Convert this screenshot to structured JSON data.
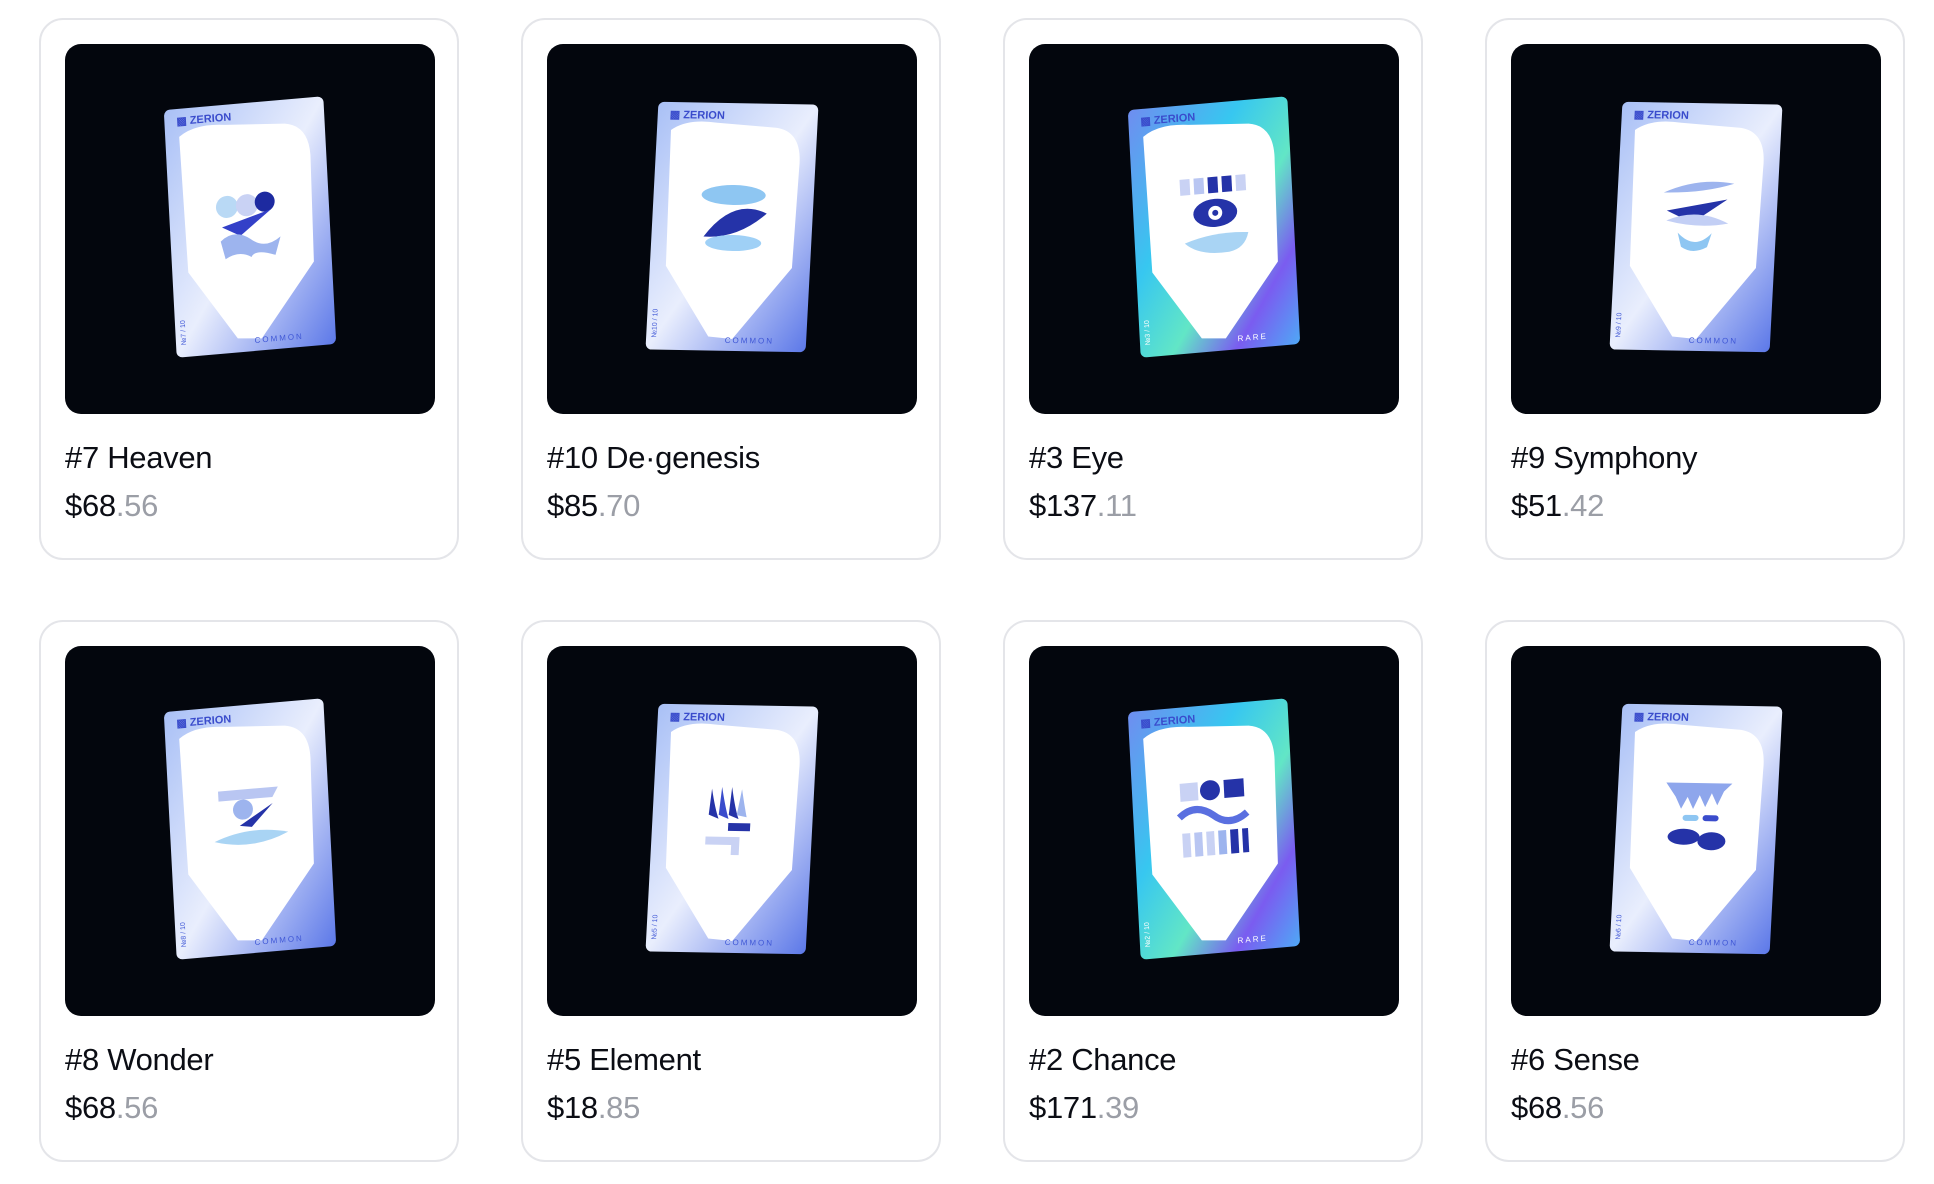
{
  "nfts": [
    {
      "name": "#7 Heaven",
      "price_main": "$68",
      "price_cents": ".56",
      "brand": "ZERION",
      "rarity": "COMMON",
      "serial": "№7 / 10",
      "variant": "common",
      "motif": "heaven",
      "icon": "heaven-card-art-icon"
    },
    {
      "name": "#10 De·genesis",
      "price_main": "$85",
      "price_cents": ".70",
      "brand": "ZERION",
      "rarity": "COMMON",
      "serial": "№10 / 10",
      "variant": "common",
      "motif": "degenesis",
      "icon": "degenesis-card-art-icon"
    },
    {
      "name": "#3 Eye",
      "price_main": "$137",
      "price_cents": ".11",
      "brand": "ZERION",
      "rarity": "RARE",
      "serial": "№3 / 10",
      "variant": "rare",
      "motif": "eye",
      "icon": "eye-card-art-icon"
    },
    {
      "name": "#9 Symphony",
      "price_main": "$51",
      "price_cents": ".42",
      "brand": "ZERION",
      "rarity": "COMMON",
      "serial": "№9 / 10",
      "variant": "common",
      "motif": "symphony",
      "icon": "symphony-card-art-icon"
    },
    {
      "name": "#8 Wonder",
      "price_main": "$68",
      "price_cents": ".56",
      "brand": "ZERION",
      "rarity": "COMMON",
      "serial": "№8 / 10",
      "variant": "common",
      "motif": "wonder",
      "icon": "wonder-card-art-icon"
    },
    {
      "name": "#5 Element",
      "price_main": "$18",
      "price_cents": ".85",
      "brand": "ZERION",
      "rarity": "COMMON",
      "serial": "№5 / 10",
      "variant": "common",
      "motif": "element",
      "icon": "element-card-art-icon"
    },
    {
      "name": "#2 Chance",
      "price_main": "$171",
      "price_cents": ".39",
      "brand": "ZERION",
      "rarity": "RARE",
      "serial": "№2 / 10",
      "variant": "rare",
      "motif": "chance",
      "icon": "chance-card-art-icon"
    },
    {
      "name": "#6 Sense",
      "price_main": "$68",
      "price_cents": ".56",
      "brand": "ZERION",
      "rarity": "COMMON",
      "serial": "№6 / 10",
      "variant": "common",
      "motif": "sense",
      "icon": "sense-card-art-icon"
    }
  ],
  "colors": {
    "art_background": "#03060d",
    "card_border": "#e4e5e9",
    "cents_color": "#9b9ea6",
    "accent_blue": "#2f3fb0"
  }
}
